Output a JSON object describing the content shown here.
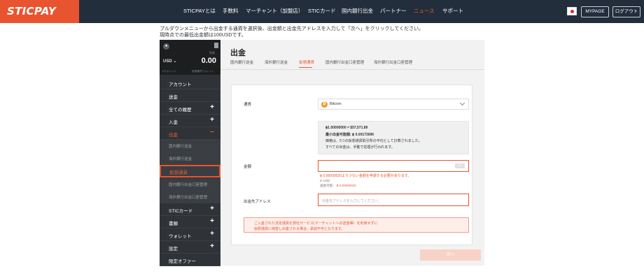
{
  "header": {
    "logo": "STICPAY",
    "nav": [
      "STICPAYとは",
      "手数料",
      "マーチャント（加盟店）",
      "STICカード",
      "国内銀行出金",
      "パートナー",
      "ニュース",
      "サポート"
    ],
    "active_nav": "ニュース",
    "mypage_label": "MYPAGE",
    "logout_label": "ログアウト"
  },
  "instructions": {
    "line1": "プルダウンメニューから出金する通貨を選択後、出金額と出金先アドレスを入力して「次へ」をクリックしてください。",
    "line2": "現時点での最低出金額は100USDです。"
  },
  "sidebar": {
    "balance_label": "残高",
    "currency": "USD",
    "balance": "0.00",
    "tabs": [
      "eウォレット",
      "仮想通貨ウォレット"
    ],
    "items": [
      {
        "label": "アカウント",
        "type": "item",
        "toggle": ""
      },
      {
        "label": "送金",
        "type": "item",
        "toggle": ""
      },
      {
        "label": "全ての履歴",
        "type": "item",
        "toggle": "+"
      },
      {
        "label": "入金",
        "type": "item",
        "toggle": "+"
      },
      {
        "label": "出金",
        "type": "open",
        "toggle": "−"
      },
      {
        "label": "国内銀行送金",
        "type": "sub",
        "toggle": ""
      },
      {
        "label": "海外銀行送金",
        "type": "sub",
        "toggle": ""
      },
      {
        "label": "仮想通貨",
        "type": "selected",
        "toggle": ""
      },
      {
        "label": "国内銀行出金口座管理",
        "type": "sub",
        "toggle": ""
      },
      {
        "label": "海外銀行出金口座管理",
        "type": "sub",
        "toggle": ""
      },
      {
        "label": "STICカード",
        "type": "item",
        "toggle": "+"
      },
      {
        "label": "書類",
        "type": "item",
        "toggle": "+"
      },
      {
        "label": "ウォレット",
        "type": "item",
        "toggle": "+"
      },
      {
        "label": "設定",
        "type": "item",
        "toggle": "+"
      },
      {
        "label": "限定オファー",
        "type": "item",
        "toggle": ""
      }
    ]
  },
  "main": {
    "title": "出金",
    "tabs": [
      "国内銀行送金",
      "海外銀行送金",
      "仮想通貨",
      "国内銀行出金口座管理",
      "海外銀行出金口座管理"
    ],
    "active_tab": "仮想通貨",
    "currency_label": "通貨",
    "currency_value": "Bitcoin",
    "currency_symbol": "₿",
    "rate_line1": "฿1.00000000 = $57,571.89",
    "rate_line2": "最小出金可能額: ฿ 0.00173696",
    "rate_line3": "価格は、5つの仮想通貨取引所の平均として計算されました。",
    "rate_line4": "すべての出金は、手動で処理が行われます。",
    "amount_label": "金額",
    "amount_tag": "BTC",
    "amount_error": "฿ 0.00000020より少ない金額を申請する必要があります。",
    "in_usd": "in USD",
    "available_label": "送金可能：",
    "available_value": "฿ 0.00000020",
    "address_label": "出金先アドレス",
    "address_placeholder": "出金先アドレスを入力してください。",
    "warning_line1": "ご入金された法定通貨を弊社サービス(マーチャントへの送金等）を利用せずに",
    "warning_line2": "仮想通貨に両替し出金される場合、承認不可となります。",
    "next_label": "次へ"
  },
  "colors": {
    "brand": "#e8542f",
    "header_bg": "#232e3c",
    "sidebar_bg": "#2f3337"
  }
}
